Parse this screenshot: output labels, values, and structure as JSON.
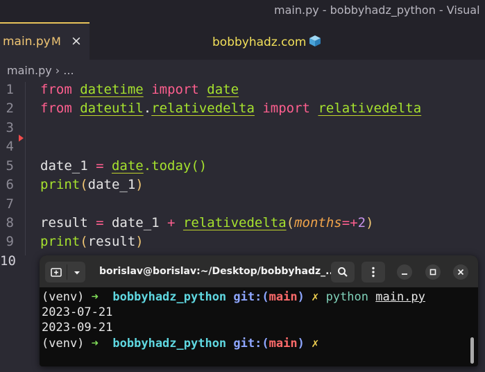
{
  "window": {
    "title": "main.py - bobbyhadz_python - Visual"
  },
  "tabs": [
    {
      "filename": "main.py",
      "status": "M",
      "close": "×"
    }
  ],
  "editor_header": {
    "site": "bobbyhadz.com"
  },
  "breadcrumb": {
    "file": "main.py",
    "sep": "›",
    "rest": "..."
  },
  "code": {
    "line_numbers": [
      "1",
      "2",
      "3",
      "4",
      "5",
      "6",
      "7",
      "8",
      "9",
      "10"
    ],
    "l1": {
      "from": "from",
      "module": "datetime",
      "import": "import",
      "name": "date"
    },
    "l2": {
      "from": "from",
      "module": "dateutil",
      "dot": ".",
      "sub": "relativedelta",
      "import": "import",
      "name": "relativedelta"
    },
    "l5": {
      "var": "date_1",
      "eq": " = ",
      "obj": "date",
      "call": ".today()"
    },
    "l6": {
      "fn": "print",
      "arg": "date_1"
    },
    "l8": {
      "var": "result",
      "eq": " = ",
      "lhs": "date_1",
      "plus": " + ",
      "fn": "relativedelta",
      "param": "months",
      "assign": "=",
      "sign": "+",
      "num": "2"
    },
    "l9": {
      "fn": "print",
      "arg": "result"
    }
  },
  "terminal": {
    "title": "borislav@borislav:~/Desktop/bobbyhadz_...",
    "lines": {
      "venv": "(venv)",
      "arrow": "➜",
      "repo": "bobbyhadz_python",
      "git": "git:(",
      "branch": "main",
      "git_close": ")",
      "x": "✗",
      "cmd": "python",
      "file": "main.py",
      "out1": "2023-07-21",
      "out2": "2023-09-21"
    }
  },
  "icons": {
    "new_tab": "new-tab-icon",
    "chevron": "chevron-down-icon",
    "search": "search-icon",
    "menu": "kebab-menu-icon",
    "minimize": "minimize-icon",
    "maximize": "maximize-icon",
    "close": "close-icon"
  },
  "colors": {
    "keyword": "#ff5f8f",
    "function": "#a6e22e",
    "number": "#c792ea",
    "terminal_bg": "#0d0d0d"
  }
}
